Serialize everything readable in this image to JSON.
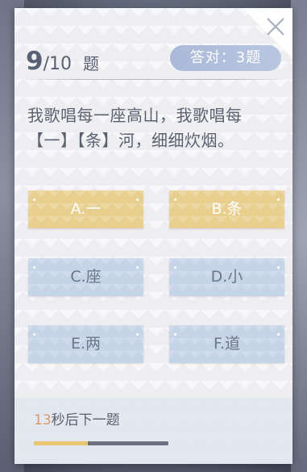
{
  "quiz": {
    "current": "9",
    "separator": "/",
    "total": "10",
    "unit": "题",
    "score_text": "答对：3题"
  },
  "question": {
    "line1": "我歌唱每一座高山，我歌唱每",
    "line2": "【一】【条】河，细细炊烟。"
  },
  "options": [
    {
      "label": "A.一",
      "state": "selected"
    },
    {
      "label": "B.条",
      "state": "selected"
    },
    {
      "label": "C.座",
      "state": "normal"
    },
    {
      "label": "D.小",
      "state": "normal"
    },
    {
      "label": "E.两",
      "state": "normal"
    },
    {
      "label": "F.道",
      "state": "normal"
    }
  ],
  "timer": {
    "seconds": "13",
    "suffix": "秒后下一题",
    "progress": 0.4
  },
  "icons": {
    "close": "close-icon"
  },
  "colors": {
    "selected_option": "#e8cf8e",
    "normal_option": "#c6d4e8",
    "badge": "#a9b9d8",
    "timer_seconds": "#d99a6a",
    "progress_fill": "#e8c66f"
  }
}
